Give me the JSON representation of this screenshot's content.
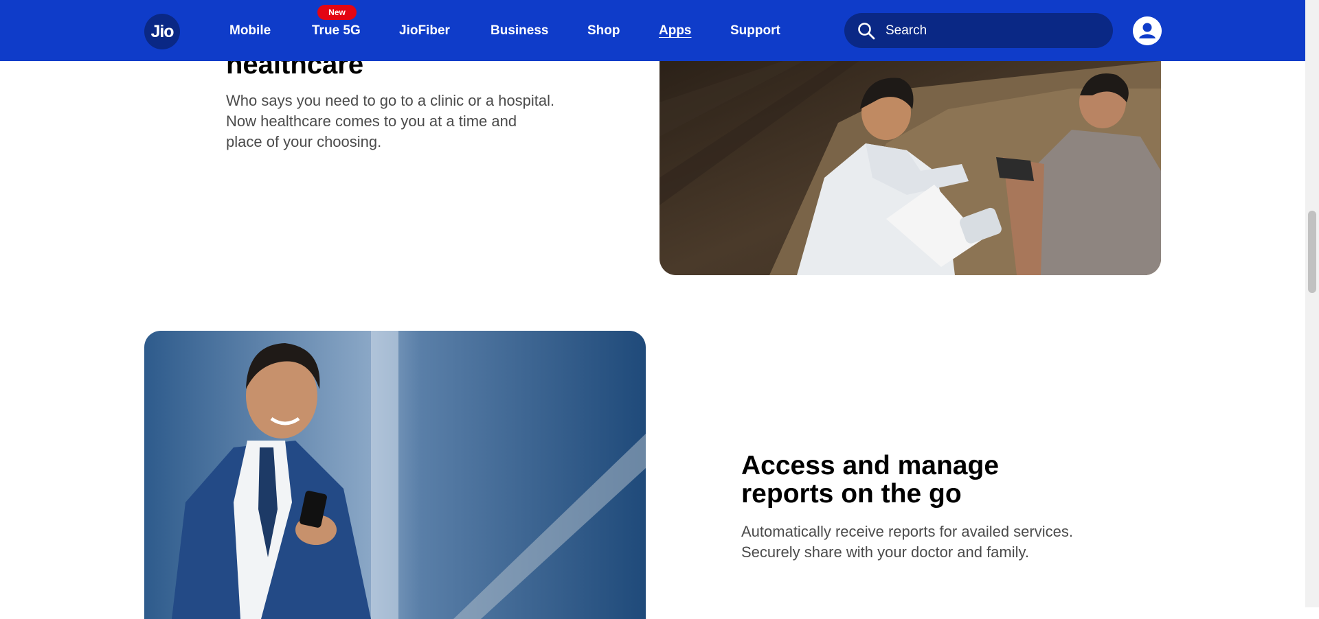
{
  "header": {
    "logo_text": "Jio",
    "nav": [
      {
        "label": "Mobile"
      },
      {
        "label": "True 5G",
        "badge": "New"
      },
      {
        "label": "JioFiber"
      },
      {
        "label": "Business"
      },
      {
        "label": "Shop"
      },
      {
        "label": "Apps",
        "active": true
      },
      {
        "label": "Support"
      }
    ],
    "search": {
      "placeholder": "Search",
      "value": "",
      "icon": "search-icon"
    },
    "profile_icon": "user-icon"
  },
  "sections": [
    {
      "heading": "healthcare",
      "body": "Who says you need to go to a clinic or a hospital. Now healthcare comes to you at a time and place of your choosing.",
      "image": "doctor-checking-blood-pressure-photo"
    },
    {
      "heading": "Access and manage reports on the go",
      "body": "Automatically receive reports for availed services. Securely share with your doctor and family.",
      "image": "businessman-using-phone-photo"
    }
  ],
  "colors": {
    "header_bg": "#0f3cc9",
    "search_bg": "#0a2885",
    "badge_red": "#e30513",
    "text_dark": "#000000",
    "text_body": "#4b4b4b"
  }
}
